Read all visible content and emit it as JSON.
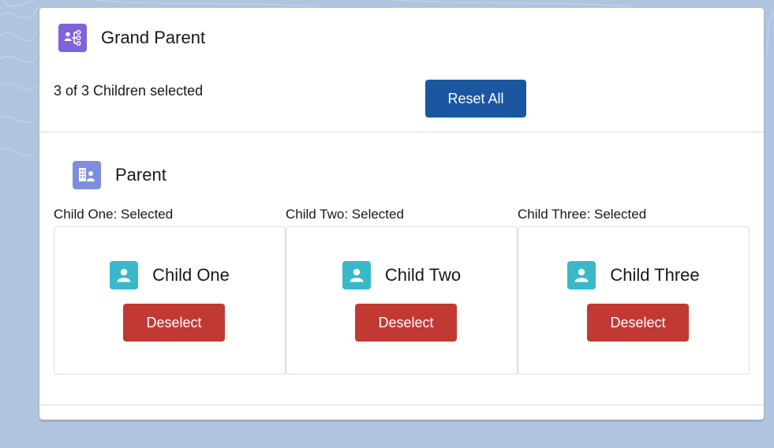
{
  "grandparent": {
    "title": "Grand Parent",
    "icon": "hierarchy-icon",
    "status_text": "3 of 3 Children selected",
    "reset_label": "Reset All"
  },
  "parent": {
    "title": "Parent",
    "icon": "building-person-icon"
  },
  "children": [
    {
      "status": "Child One: Selected",
      "name": "Child One",
      "button_label": "Deselect",
      "icon": "user-icon"
    },
    {
      "status": "Child Two: Selected",
      "name": "Child Two",
      "button_label": "Deselect",
      "icon": "user-icon"
    },
    {
      "status": "Child Three: Selected",
      "name": "Child Three",
      "button_label": "Deselect",
      "icon": "user-icon"
    }
  ],
  "colors": {
    "background": "#b0c4df",
    "brand_button": "#1b56a0",
    "destructive_button": "#c23934",
    "grandparent_icon": "#7f63d9",
    "parent_icon": "#7f8de1",
    "child_icon": "#3ab8c9"
  }
}
